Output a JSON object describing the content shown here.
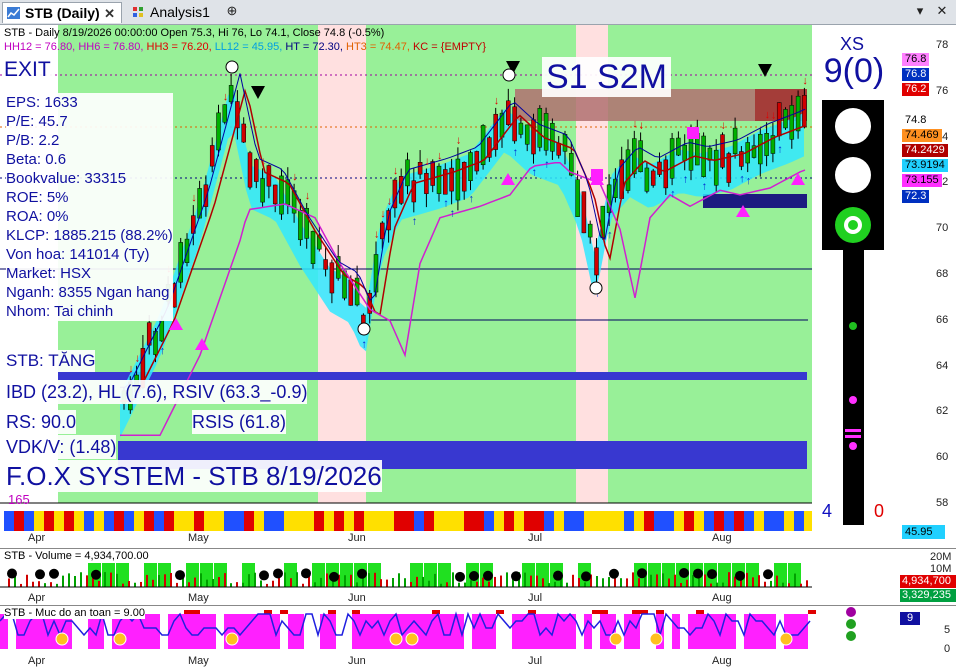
{
  "tabs": [
    {
      "label": "STB (Daily)",
      "active": true
    },
    {
      "label": "Analysis1",
      "active": false
    }
  ],
  "chart": {
    "title_line": "STB - Daily 8/19/2026 00:00:00 Open 75.3, Hi 76, Lo 74.1, Close 74.8 (-0.5%)",
    "levels_line": [
      {
        "text": "HH12 = 76.80,",
        "color": "#c000c0"
      },
      {
        "text": "HH6 = 76.80,",
        "color": "#c000c0"
      },
      {
        "text": "HH3 = 76.20,",
        "color": "#e00000"
      },
      {
        "text": "LL12 = 45.95,",
        "color": "#00a0e0"
      },
      {
        "text": "HT  = 72.30,",
        "color": "#000080"
      },
      {
        "text": "HT3  = 74.47,",
        "color": "#e06000"
      },
      {
        "text": "KC = {EMPTY}",
        "color": "#c00000"
      }
    ],
    "exit_label": "EXIT",
    "fundamentals": [
      "EPS: 1633",
      "P/E: 45.7",
      "P/B: 2.2",
      "Beta: 0.6",
      "Bookvalue: 33315",
      "ROE: 5%",
      "ROA: 0%",
      "KLCP: 1885.215 (88.2%)",
      "Von hoa: 141014 (Ty)",
      "Market: HSX",
      "Nganh: 8355 Ngan hang",
      "Nhom: Tai chinh"
    ],
    "trend_label": "STB: TĂNG",
    "ibd_line": "IBD (23.2), HL (7.6), RSIV (63.3_-0.9)",
    "rs_label": "RS: 90.0",
    "rsis_label": "RSIS (61.8)",
    "vdk_label": "VDK/V:  (1.48)",
    "system_label": "F.O.X SYSTEM - STB 8/19/2026",
    "count_label": "165",
    "signal_label": "S1  S2M",
    "xs_label": "XS",
    "xs_value": "9(0)",
    "left_count": "4",
    "right_count": "0",
    "bottom_tag": "45.95",
    "y_ticks": [
      "78",
      "76",
      "74",
      "72",
      "70",
      "68",
      "66",
      "64",
      "62",
      "60",
      "58"
    ],
    "price_tags": [
      {
        "text": "76.8",
        "bg": "#ff80ff",
        "fg": "#000"
      },
      {
        "text": "76.8",
        "bg": "#0030c0",
        "fg": "#fff"
      },
      {
        "text": "76.2",
        "bg": "#e00000",
        "fg": "#fff"
      },
      {
        "text": "74.8",
        "bg": "#ffffff",
        "fg": "#000"
      },
      {
        "text": "74.469",
        "bg": "#ff9020",
        "fg": "#000"
      },
      {
        "text": "74.2429",
        "bg": "#b00000",
        "fg": "#fff"
      },
      {
        "text": "73.9194",
        "bg": "#20d0ff",
        "fg": "#000"
      },
      {
        "text": "73.155",
        "bg": "#ff30ff",
        "fg": "#000"
      },
      {
        "text": "72.3",
        "bg": "#0030c0",
        "fg": "#fff"
      }
    ],
    "months": [
      "Apr",
      "May",
      "Jun",
      "Jul",
      "Aug"
    ]
  },
  "volume": {
    "title": "STB - Volume = 4,934,700.00",
    "ticks": [
      "20M",
      "10M"
    ],
    "tags": [
      {
        "text": "4,934,700",
        "bg": "#e00000",
        "fg": "#fff"
      },
      {
        "text": "3,329,235",
        "bg": "#00a040",
        "fg": "#fff"
      }
    ],
    "months": [
      "Apr",
      "May",
      "Jun",
      "Jul",
      "Aug"
    ]
  },
  "safety": {
    "title": "STB - Muc do an toan = 9.00",
    "ticks": [
      "5",
      "0"
    ],
    "tag": "9",
    "months": [
      "Apr",
      "May",
      "Jun",
      "Jul",
      "Aug"
    ]
  },
  "colors": {
    "green_zone": "#98f098",
    "pink_zone": "#ffe0e0",
    "blue_bar": "#3838d0",
    "brown_box": "#b07070",
    "up_candle": "#00b000",
    "down_candle": "#d00000"
  }
}
